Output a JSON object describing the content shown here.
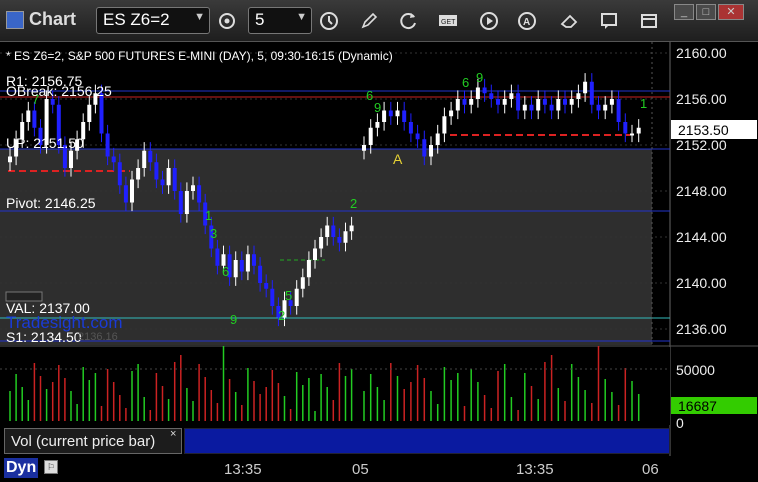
{
  "app": {
    "title": "Chart"
  },
  "toolbar": {
    "symbol": "ES Z6=2",
    "period": "5",
    "icons": [
      "gear-icon",
      "clock-icon",
      "pencil-icon",
      "refresh-icon",
      "get-icon",
      "play-icon",
      "alert-icon",
      "eraser-icon",
      "comment-icon",
      "minimize-icon",
      "maximize-icon",
      "close-icon"
    ]
  },
  "chart_header": "* ES Z6=2, S&P 500 FUTURES E-MINI (DAY), 5, 09:30-16:15 (Dynamic)",
  "price_axis": {
    "ticks": [
      "2160.00",
      "2156.00",
      "2152.00",
      "2148.00",
      "2144.00",
      "2140.00",
      "2136.00"
    ],
    "current_price": "2153.50"
  },
  "levels": {
    "r1": "R1: 2156.75",
    "obreak": "OBreak: 2156.25",
    "up": "UP: 2151.50",
    "pivot": "Pivot: 2146.25",
    "val": "VAL: 2137.00",
    "s1": "S1: 2134.50",
    "watermark": "Tradesight.com",
    "ghost": "2136.16",
    "a_marker": "A"
  },
  "volume": {
    "ticks": [
      "50000",
      "0"
    ],
    "current": "16687",
    "tab_label": "Vol (current price bar)"
  },
  "time_axis": {
    "labels": [
      "13:35",
      "05",
      "13:35",
      "06"
    ]
  },
  "footer": {
    "dyn": "Dyn"
  },
  "colors": {
    "up_bar": "#ffffff",
    "down_bar": "#0000ff",
    "vol_up": "#22cc22",
    "vol_down": "#cc2222",
    "level_line": "#2233cc",
    "dash": "#dd2222",
    "current_price_bg": "#ffffff",
    "vol_current_bg": "#33cc00"
  },
  "chart_data": {
    "type": "candlestick",
    "series": [
      {
        "name": "ES Z6=2"
      }
    ],
    "y_range": [
      2135,
      2162
    ],
    "closes_day1": [
      2151.0,
      2152.5,
      2154.0,
      2155.0,
      2153.5,
      2152.0,
      2156.0,
      2155.5,
      2152.0,
      2150.0,
      2151.5,
      2152.5,
      2154.0,
      2155.5,
      2156.5,
      2153.0,
      2151.0,
      2150.5,
      2148.5,
      2147.0,
      2149.0,
      2150.0,
      2151.5,
      2150.5,
      2149.0,
      2148.5,
      2150.0,
      2148.0,
      2146.0,
      2148.0,
      2148.5,
      2147.0,
      2145.0,
      2143.0,
      2141.5,
      2142.5,
      2140.5,
      2142.0,
      2141.0,
      2142.5,
      2141.5,
      2140.0,
      2139.5,
      2138.0,
      2137.0,
      2138.5,
      2138.0,
      2139.5,
      2140.5,
      2142.0,
      2143.0,
      2144.0,
      2145.0,
      2144.0,
      2143.5,
      2144.5,
      2145.0
    ],
    "closes_day2": [
      2152.0,
      2153.5,
      2154.0,
      2155.0,
      2154.5,
      2155.0,
      2154.0,
      2153.0,
      2152.5,
      2151.0,
      2152.0,
      2153.0,
      2154.5,
      2155.0,
      2156.0,
      2155.5,
      2156.0,
      2157.0,
      2156.5,
      2156.0,
      2155.5,
      2156.0,
      2156.5,
      2155.0,
      2155.5,
      2155.0,
      2156.0,
      2155.5,
      2155.0,
      2156.0,
      2155.5,
      2156.0,
      2156.5,
      2157.5,
      2155.5,
      2155.0,
      2155.5,
      2156.0,
      2154.0,
      2153.0,
      2153.0,
      2153.5
    ]
  }
}
